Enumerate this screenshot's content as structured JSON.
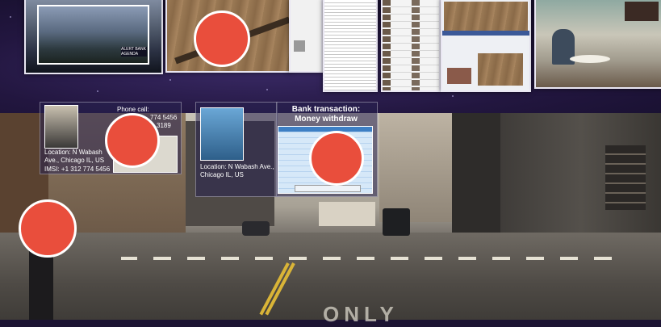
{
  "overlays": {
    "phone": {
      "label": "Phone call:",
      "numbers": [
        "774 5456",
        "3189"
      ],
      "location": "Location: N Wabash Ave., Chicago IL, US",
      "imsi": "IMSI: +1 312 774 5456"
    },
    "atm": {
      "location": "Location: N Wabash Ave., Chicago IL, US"
    },
    "bank": {
      "title_line1": "Bank transaction:",
      "title_line2": "Money withdraw"
    }
  },
  "thumbnails": {
    "aerial_caption": "ALERT BANK AGENDA",
    "street_sign": "ONLY"
  },
  "colors": {
    "marker": "#e94e3c",
    "background": "#1d1433"
  }
}
